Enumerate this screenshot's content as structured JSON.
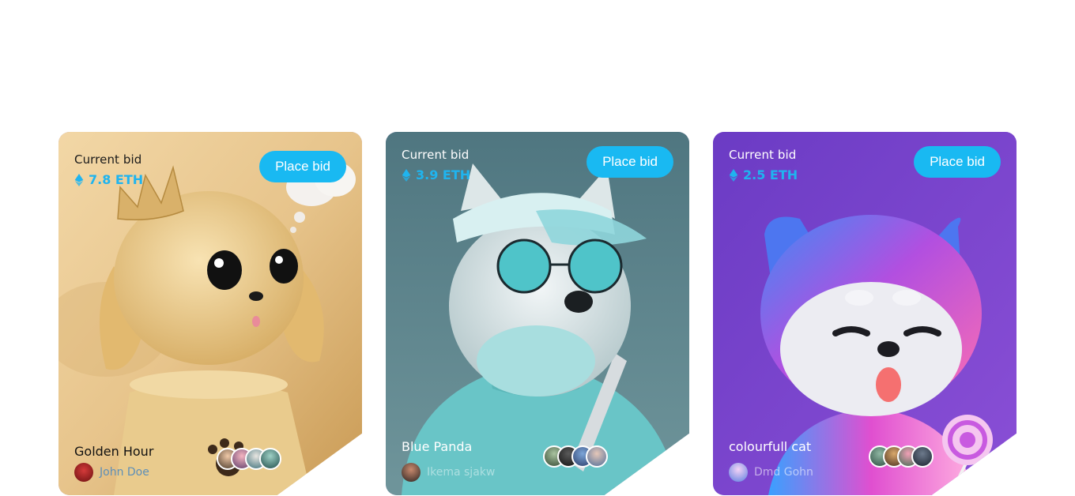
{
  "cards": [
    {
      "bid_label": "Current bid",
      "bid_amount": "7.8 ETH",
      "button_label": "Place bid",
      "title": "Golden Hour",
      "owner": "John Doe"
    },
    {
      "bid_label": "Current bid",
      "bid_amount": "3.9 ETH",
      "button_label": "Place bid",
      "title": "Blue Panda",
      "owner": "Ikema sjakw"
    },
    {
      "bid_label": "Current bid",
      "bid_amount": "2.5 ETH",
      "button_label": "Place bid",
      "title": "colourfull cat",
      "owner": "Dmd Gohn"
    }
  ],
  "colors": {
    "accent": "#19b9f2",
    "eth_text": "#1fb4ef"
  }
}
